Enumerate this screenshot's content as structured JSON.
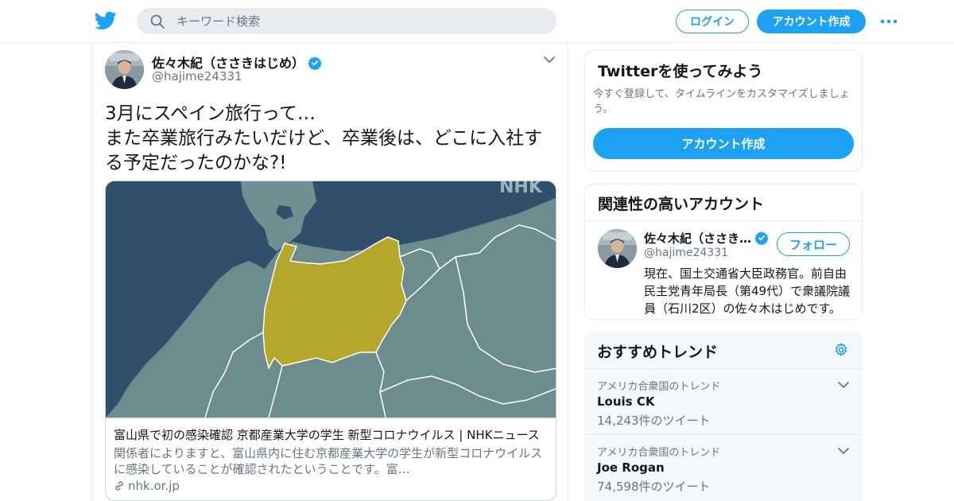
{
  "topbar": {
    "search_placeholder": "キーワード検索",
    "login_label": "ログイン",
    "signup_label": "アカウント作成"
  },
  "tweet": {
    "author_name": "佐々木紀（ささきはじめ）",
    "author_handle": "@hajime24331",
    "text_line1": "3月にスペイン旅行って…",
    "text_line2": "また卒業旅行みたいだけど、卒業後は、どこに入社す",
    "text_line3": "る予定だったのかな?!",
    "card": {
      "watermark": "NHK",
      "title": "富山県で初の感染確認 京都産業大学の学生 新型コロナウイルス | NHKニュース",
      "desc_line1": "関係者によりますと、富山県内に住む京都産業大学の学生が新型コロナウイルス",
      "desc_line2": "に感染していることが確認されたということです。富…",
      "domain": "nhk.or.jp"
    }
  },
  "signup_box": {
    "title": "Twitterを使ってみよう",
    "desc_line1": "今すぐ登録して、タイムラインをカスタマイズしましょ",
    "desc_line2": "う。",
    "button_label": "アカウント作成"
  },
  "related": {
    "title": "関連性の高いアカウント",
    "name": "佐々木紀（ささき…",
    "handle": "@hajime24331",
    "follow_label": "フォロー",
    "bio_line1": "現在、国土交通省大臣政務官。前自由",
    "bio_line2": "民主党青年局長（第49代）で衆議院議",
    "bio_line3": "員（石川2区）の佐々木はじめです。"
  },
  "trends": {
    "title": "おすすめトレンド",
    "items": [
      {
        "context": "アメリカ合衆国のトレンド",
        "name": "Louis CK",
        "count": "14,243件のツイート"
      },
      {
        "context": "アメリカ合衆国のトレンド",
        "name": "Joe Rogan",
        "count": "74,598件のツイート"
      }
    ]
  },
  "colors": {
    "accent": "#1da1f2",
    "map_sea": "#2f4f6b",
    "map_land": "#6f8f90",
    "map_highlight": "#b5a72b"
  }
}
